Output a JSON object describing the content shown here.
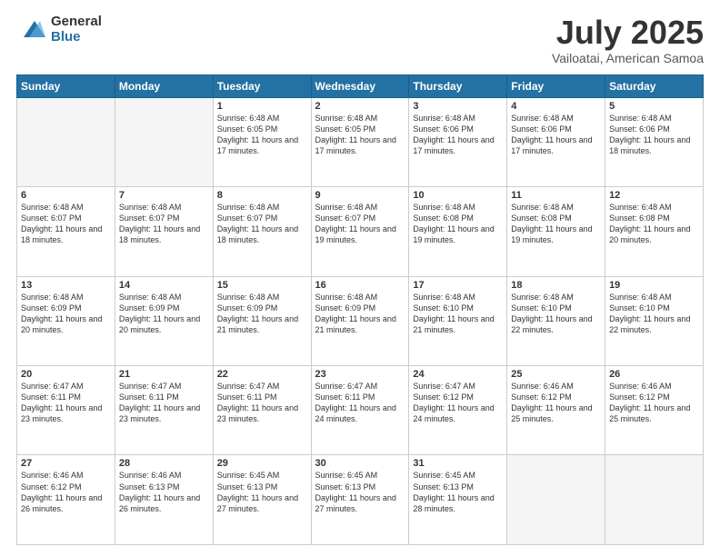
{
  "logo": {
    "general": "General",
    "blue": "Blue"
  },
  "header": {
    "month": "July 2025",
    "location": "Vailoatai, American Samoa"
  },
  "weekdays": [
    "Sunday",
    "Monday",
    "Tuesday",
    "Wednesday",
    "Thursday",
    "Friday",
    "Saturday"
  ],
  "weeks": [
    [
      {
        "day": "",
        "empty": true
      },
      {
        "day": "",
        "empty": true
      },
      {
        "day": "1",
        "sunrise": "Sunrise: 6:48 AM",
        "sunset": "Sunset: 6:05 PM",
        "daylight": "Daylight: 11 hours and 17 minutes."
      },
      {
        "day": "2",
        "sunrise": "Sunrise: 6:48 AM",
        "sunset": "Sunset: 6:05 PM",
        "daylight": "Daylight: 11 hours and 17 minutes."
      },
      {
        "day": "3",
        "sunrise": "Sunrise: 6:48 AM",
        "sunset": "Sunset: 6:06 PM",
        "daylight": "Daylight: 11 hours and 17 minutes."
      },
      {
        "day": "4",
        "sunrise": "Sunrise: 6:48 AM",
        "sunset": "Sunset: 6:06 PM",
        "daylight": "Daylight: 11 hours and 17 minutes."
      },
      {
        "day": "5",
        "sunrise": "Sunrise: 6:48 AM",
        "sunset": "Sunset: 6:06 PM",
        "daylight": "Daylight: 11 hours and 18 minutes."
      }
    ],
    [
      {
        "day": "6",
        "sunrise": "Sunrise: 6:48 AM",
        "sunset": "Sunset: 6:07 PM",
        "daylight": "Daylight: 11 hours and 18 minutes."
      },
      {
        "day": "7",
        "sunrise": "Sunrise: 6:48 AM",
        "sunset": "Sunset: 6:07 PM",
        "daylight": "Daylight: 11 hours and 18 minutes."
      },
      {
        "day": "8",
        "sunrise": "Sunrise: 6:48 AM",
        "sunset": "Sunset: 6:07 PM",
        "daylight": "Daylight: 11 hours and 18 minutes."
      },
      {
        "day": "9",
        "sunrise": "Sunrise: 6:48 AM",
        "sunset": "Sunset: 6:07 PM",
        "daylight": "Daylight: 11 hours and 19 minutes."
      },
      {
        "day": "10",
        "sunrise": "Sunrise: 6:48 AM",
        "sunset": "Sunset: 6:08 PM",
        "daylight": "Daylight: 11 hours and 19 minutes."
      },
      {
        "day": "11",
        "sunrise": "Sunrise: 6:48 AM",
        "sunset": "Sunset: 6:08 PM",
        "daylight": "Daylight: 11 hours and 19 minutes."
      },
      {
        "day": "12",
        "sunrise": "Sunrise: 6:48 AM",
        "sunset": "Sunset: 6:08 PM",
        "daylight": "Daylight: 11 hours and 20 minutes."
      }
    ],
    [
      {
        "day": "13",
        "sunrise": "Sunrise: 6:48 AM",
        "sunset": "Sunset: 6:09 PM",
        "daylight": "Daylight: 11 hours and 20 minutes."
      },
      {
        "day": "14",
        "sunrise": "Sunrise: 6:48 AM",
        "sunset": "Sunset: 6:09 PM",
        "daylight": "Daylight: 11 hours and 20 minutes."
      },
      {
        "day": "15",
        "sunrise": "Sunrise: 6:48 AM",
        "sunset": "Sunset: 6:09 PM",
        "daylight": "Daylight: 11 hours and 21 minutes."
      },
      {
        "day": "16",
        "sunrise": "Sunrise: 6:48 AM",
        "sunset": "Sunset: 6:09 PM",
        "daylight": "Daylight: 11 hours and 21 minutes."
      },
      {
        "day": "17",
        "sunrise": "Sunrise: 6:48 AM",
        "sunset": "Sunset: 6:10 PM",
        "daylight": "Daylight: 11 hours and 21 minutes."
      },
      {
        "day": "18",
        "sunrise": "Sunrise: 6:48 AM",
        "sunset": "Sunset: 6:10 PM",
        "daylight": "Daylight: 11 hours and 22 minutes."
      },
      {
        "day": "19",
        "sunrise": "Sunrise: 6:48 AM",
        "sunset": "Sunset: 6:10 PM",
        "daylight": "Daylight: 11 hours and 22 minutes."
      }
    ],
    [
      {
        "day": "20",
        "sunrise": "Sunrise: 6:47 AM",
        "sunset": "Sunset: 6:11 PM",
        "daylight": "Daylight: 11 hours and 23 minutes."
      },
      {
        "day": "21",
        "sunrise": "Sunrise: 6:47 AM",
        "sunset": "Sunset: 6:11 PM",
        "daylight": "Daylight: 11 hours and 23 minutes."
      },
      {
        "day": "22",
        "sunrise": "Sunrise: 6:47 AM",
        "sunset": "Sunset: 6:11 PM",
        "daylight": "Daylight: 11 hours and 23 minutes."
      },
      {
        "day": "23",
        "sunrise": "Sunrise: 6:47 AM",
        "sunset": "Sunset: 6:11 PM",
        "daylight": "Daylight: 11 hours and 24 minutes."
      },
      {
        "day": "24",
        "sunrise": "Sunrise: 6:47 AM",
        "sunset": "Sunset: 6:12 PM",
        "daylight": "Daylight: 11 hours and 24 minutes."
      },
      {
        "day": "25",
        "sunrise": "Sunrise: 6:46 AM",
        "sunset": "Sunset: 6:12 PM",
        "daylight": "Daylight: 11 hours and 25 minutes."
      },
      {
        "day": "26",
        "sunrise": "Sunrise: 6:46 AM",
        "sunset": "Sunset: 6:12 PM",
        "daylight": "Daylight: 11 hours and 25 minutes."
      }
    ],
    [
      {
        "day": "27",
        "sunrise": "Sunrise: 6:46 AM",
        "sunset": "Sunset: 6:12 PM",
        "daylight": "Daylight: 11 hours and 26 minutes."
      },
      {
        "day": "28",
        "sunrise": "Sunrise: 6:46 AM",
        "sunset": "Sunset: 6:13 PM",
        "daylight": "Daylight: 11 hours and 26 minutes."
      },
      {
        "day": "29",
        "sunrise": "Sunrise: 6:45 AM",
        "sunset": "Sunset: 6:13 PM",
        "daylight": "Daylight: 11 hours and 27 minutes."
      },
      {
        "day": "30",
        "sunrise": "Sunrise: 6:45 AM",
        "sunset": "Sunset: 6:13 PM",
        "daylight": "Daylight: 11 hours and 27 minutes."
      },
      {
        "day": "31",
        "sunrise": "Sunrise: 6:45 AM",
        "sunset": "Sunset: 6:13 PM",
        "daylight": "Daylight: 11 hours and 28 minutes."
      },
      {
        "day": "",
        "empty": true
      },
      {
        "day": "",
        "empty": true
      }
    ]
  ]
}
